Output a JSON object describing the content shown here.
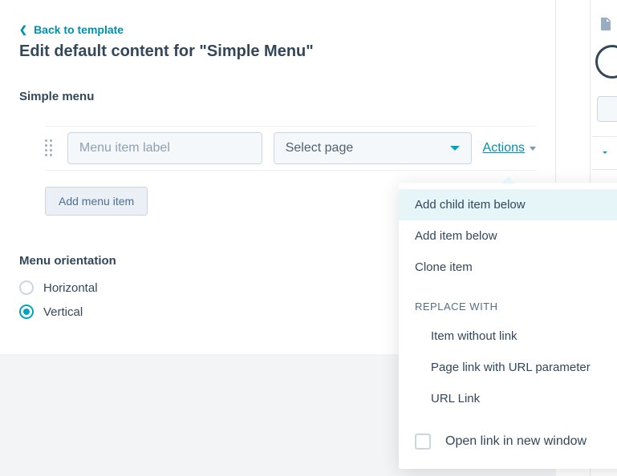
{
  "back_link": "Back to template",
  "page_title": "Edit default content for \"Simple Menu\"",
  "section_heading": "Simple menu",
  "menu_item": {
    "label_placeholder": "Menu item label",
    "label_value": "",
    "page_select_label": "Select page",
    "actions_label": "Actions"
  },
  "add_button": "Add menu item",
  "orientation": {
    "heading": "Menu orientation",
    "options": [
      {
        "label": "Horizontal",
        "selected": false
      },
      {
        "label": "Vertical",
        "selected": true
      }
    ]
  },
  "actions_menu": {
    "items": [
      "Add child item below",
      "Add item below",
      "Clone item"
    ],
    "replace_header": "REPLACE WITH",
    "replace_items": [
      "Item without link",
      "Page link with URL parameter",
      "URL Link"
    ],
    "open_new_window": "Open link in new window"
  }
}
